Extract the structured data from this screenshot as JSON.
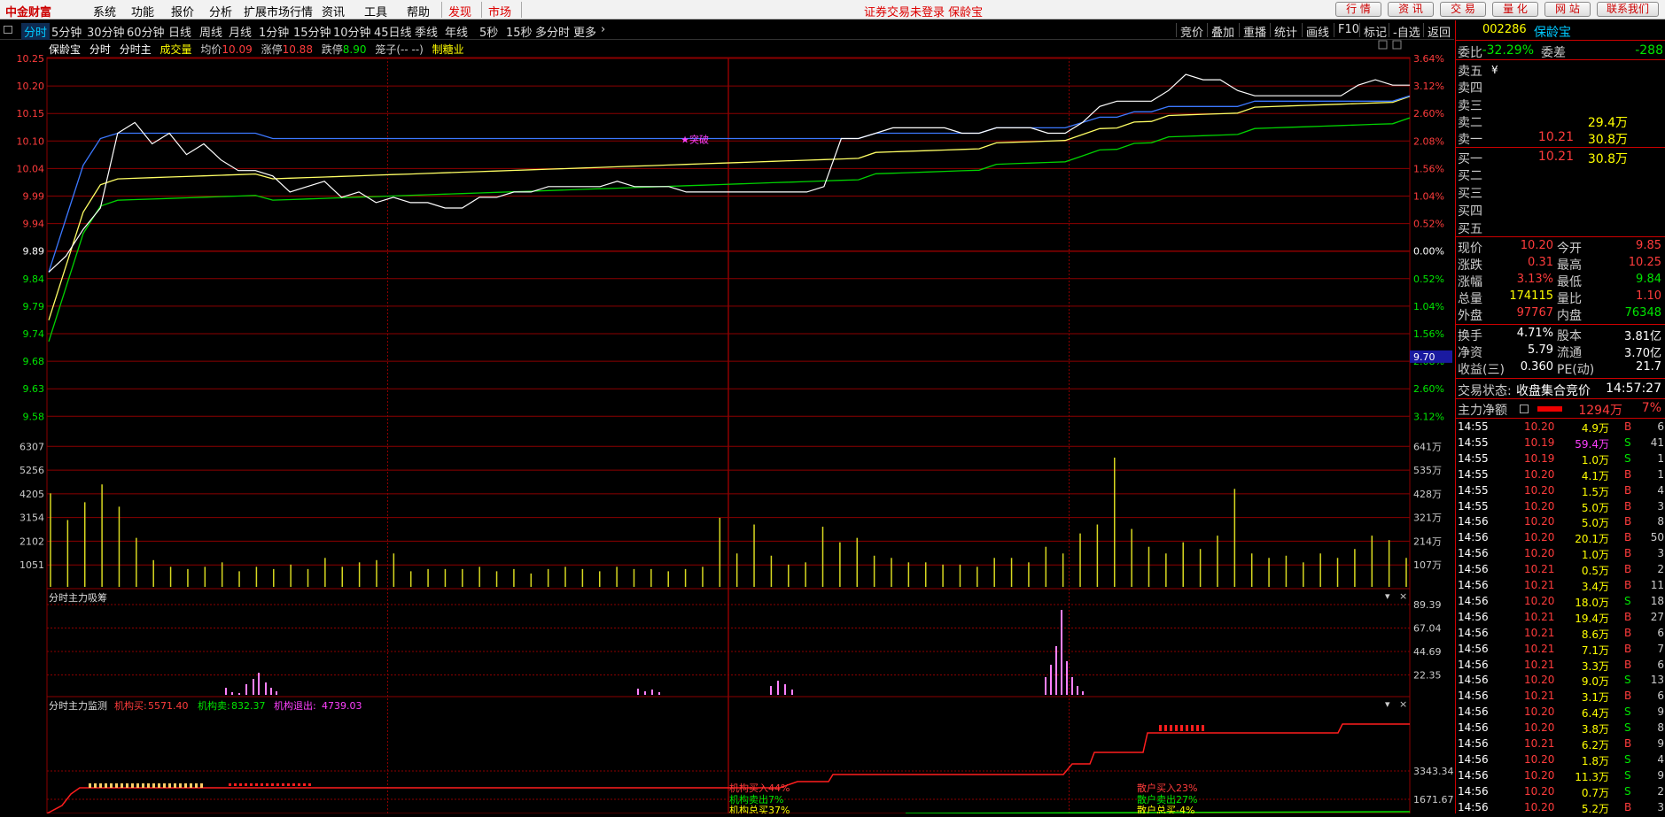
{
  "app": {
    "logo": "中金财富",
    "menu": [
      "系统",
      "功能",
      "报价",
      "分析",
      "扩展市场行情",
      "资讯",
      "工具",
      "帮助"
    ],
    "menu_red": [
      "发现",
      "市场"
    ],
    "notice": "证券交易未登录  保龄宝",
    "buttons": [
      "行 情",
      "资 讯",
      "交 易",
      "量 化",
      "网 站",
      "联系我们"
    ]
  },
  "periods": [
    "分时",
    "5分钟",
    "30分钟",
    "60分钟",
    "日线",
    "周线",
    "月线",
    "1分钟",
    "15分钟",
    "10分钟",
    "45日线",
    "季线",
    "年线",
    "5秒",
    "15秒",
    "多分时",
    "更多"
  ],
  "tools": [
    "竞价",
    "叠加",
    "重播",
    "统计",
    "画线",
    "F10",
    "标记",
    "-自选",
    "返回"
  ],
  "header": {
    "name": "保龄宝",
    "t1": "分时",
    "t2": "分时主",
    "vol": "成交量",
    "avg_label": "均价",
    "avg": "10.09",
    "up_label": "涨停",
    "up": "10.88",
    "dn_label": "跌停",
    "dn": "8.90",
    "note": "笼子(-- --)",
    "sector": "制糖业"
  },
  "price_axis": {
    "left": [
      "10.25",
      "10.20",
      "10.15",
      "10.10",
      "10.04",
      "9.99",
      "9.94",
      "9.89",
      "9.84",
      "9.79",
      "9.74",
      "9.68",
      "9.63",
      "9.58"
    ],
    "right": [
      "3.64%",
      "3.12%",
      "2.60%",
      "2.08%",
      "1.56%",
      "1.04%",
      "0.52%",
      "0.00%",
      "0.52%",
      "1.04%",
      "1.56%",
      "2.08%",
      "2.60%",
      "3.12%"
    ],
    "cursor_value": "9.70",
    "marker": "突破"
  },
  "volume_axis": {
    "left": [
      "6307",
      "5256",
      "4205",
      "3154",
      "2102",
      "1051"
    ],
    "right": [
      "641万",
      "535万",
      "428万",
      "321万",
      "214万",
      "107万"
    ]
  },
  "panel2": {
    "title": "分时主力吸筹",
    "right": [
      "89.39",
      "67.04",
      "44.69",
      "22.35"
    ]
  },
  "panel3": {
    "title": "分时主力监测",
    "buy_label": "机构买:",
    "buy": "5571.40",
    "sell_label": "机构卖:",
    "sell": "832.37",
    "exit_label": "机构退出:",
    "exit": "4739.03",
    "right": [
      "3343.34",
      "1671.67"
    ],
    "annots": [
      "机构买入44%",
      "机构卖出7%",
      "机构总买37%",
      "散户买入23%",
      "散户卖出27%",
      "散户总买-4%"
    ]
  },
  "quote": {
    "code": "002286",
    "name": "保龄宝",
    "wb_label": "委比",
    "wb": "-32.29%",
    "wc_label": "委差",
    "wc": "-288",
    "asks": [
      {
        "l": "卖五",
        "p": "",
        "v": ""
      },
      {
        "l": "卖四",
        "p": "",
        "v": ""
      },
      {
        "l": "卖三",
        "p": "",
        "v": ""
      },
      {
        "l": "卖二",
        "p": "",
        "v": "29.4万"
      },
      {
        "l": "卖一",
        "p": "10.21",
        "v": "30.8万"
      }
    ],
    "bids": [
      {
        "l": "买一",
        "p": "10.21",
        "v": "30.8万"
      },
      {
        "l": "买二",
        "p": "",
        "v": ""
      },
      {
        "l": "买三",
        "p": "",
        "v": ""
      },
      {
        "l": "买四",
        "p": "",
        "v": ""
      },
      {
        "l": "买五",
        "p": "",
        "v": ""
      }
    ],
    "stats": [
      [
        "现价",
        "10.20",
        "今开",
        "9.85"
      ],
      [
        "涨跌",
        "0.31",
        "最高",
        "10.25"
      ],
      [
        "涨幅",
        "3.13%",
        "最低",
        "9.84"
      ],
      [
        "总量",
        "174115",
        "量比",
        "1.10"
      ],
      [
        "外盘",
        "97767",
        "内盘",
        "76348"
      ]
    ],
    "stats2": [
      [
        "换手",
        "4.71%",
        "股本",
        "3.81亿"
      ],
      [
        "净资",
        "5.79",
        "流通",
        "3.70亿"
      ],
      [
        "收益(三)",
        "0.360",
        "PE(动)",
        "21.7"
      ]
    ],
    "status_label": "交易状态:",
    "status": "收盘集合竞价",
    "time": "14:57:27",
    "mainnet_label": "主力净额",
    "mainnet": "1294万",
    "mainnet_pct": "7%"
  },
  "ticks": [
    [
      "14:55",
      "10.20",
      "4.9万",
      "B",
      "6"
    ],
    [
      "14:55",
      "10.19",
      "59.4万",
      "S",
      "41"
    ],
    [
      "14:55",
      "10.19",
      "1.0万",
      "S",
      "1"
    ],
    [
      "14:55",
      "10.20",
      "4.1万",
      "B",
      "1"
    ],
    [
      "14:55",
      "10.20",
      "1.5万",
      "B",
      "4"
    ],
    [
      "14:55",
      "10.20",
      "5.0万",
      "B",
      "3"
    ],
    [
      "14:56",
      "10.20",
      "5.0万",
      "B",
      "8"
    ],
    [
      "14:56",
      "10.20",
      "20.1万",
      "B",
      "50"
    ],
    [
      "14:56",
      "10.20",
      "1.0万",
      "B",
      "3"
    ],
    [
      "14:56",
      "10.21",
      "0.5万",
      "B",
      "2"
    ],
    [
      "14:56",
      "10.21",
      "3.4万",
      "B",
      "11"
    ],
    [
      "14:56",
      "10.20",
      "18.0万",
      "S",
      "18"
    ],
    [
      "14:56",
      "10.21",
      "19.4万",
      "B",
      "27"
    ],
    [
      "14:56",
      "10.21",
      "8.6万",
      "B",
      "6"
    ],
    [
      "14:56",
      "10.21",
      "7.1万",
      "B",
      "7"
    ],
    [
      "14:56",
      "10.21",
      "3.3万",
      "B",
      "6"
    ],
    [
      "14:56",
      "10.20",
      "9.0万",
      "S",
      "13"
    ],
    [
      "14:56",
      "10.21",
      "3.1万",
      "B",
      "6"
    ],
    [
      "14:56",
      "10.20",
      "6.4万",
      "S",
      "9"
    ],
    [
      "14:56",
      "10.20",
      "3.8万",
      "S",
      "8"
    ],
    [
      "14:56",
      "10.21",
      "6.2万",
      "B",
      "9"
    ],
    [
      "14:56",
      "10.20",
      "1.8万",
      "S",
      "4"
    ],
    [
      "14:56",
      "10.20",
      "11.3万",
      "S",
      "9"
    ],
    [
      "14:56",
      "10.20",
      "0.7万",
      "S",
      "2"
    ],
    [
      "14:56",
      "10.20",
      "5.2万",
      "B",
      "3"
    ]
  ],
  "colors": {
    "up": "#ff3c3c",
    "down": "#00e600",
    "yellow": "#ffff00",
    "grid": "#8c0000",
    "price_line": "#ffffff",
    "avg_line": "#3c78ff",
    "ma1": "#ffff64",
    "ma2": "#00d200",
    "accum": "#ff80ff",
    "monitor": "#ff1e1e"
  },
  "chart_data": [
    {
      "type": "line",
      "title": "分时",
      "series": [
        {
          "name": "",
          "values": [
            9.85,
            9.88,
            9.93,
            9.97,
            10.11,
            10.13,
            10.09,
            10.11,
            10.07,
            10.09,
            10.06,
            10.04,
            10.04,
            10.03,
            10.0,
            10.01,
            10.02,
            9.99,
            10.0,
            9.98,
            9.99,
            9.98,
            9.98,
            9.97,
            9.97,
            9.99,
            9.99,
            10.0,
            10.0,
            10.01,
            10.01,
            10.01,
            10.01,
            10.02,
            10.01,
            10.01,
            10.01,
            10.0,
            10.0,
            10.0,
            10.0,
            10.0,
            10.0,
            10.0,
            10.0,
            10.01,
            10.1,
            10.1,
            10.11,
            10.12,
            10.12,
            10.12,
            10.12,
            10.11,
            10.11,
            10.12,
            10.12,
            10.12,
            10.11,
            10.11,
            10.13,
            10.16,
            10.17,
            10.17,
            10.17,
            10.19,
            10.22,
            10.21,
            10.21,
            10.19,
            10.18,
            10.18,
            10.18,
            10.18,
            10.18,
            10.18,
            10.2,
            10.21,
            10.2,
            10.2
          ]
        },
        {
          "name": "均价",
          "values": [
            9.85,
            9.95,
            10.05,
            10.1,
            10.11,
            10.11,
            10.11,
            10.11,
            10.11,
            10.11,
            10.11,
            10.11,
            10.11,
            10.1,
            10.1,
            10.1,
            10.1,
            10.1,
            10.1,
            10.1,
            10.1,
            10.1,
            10.1,
            10.1,
            10.1,
            10.1,
            10.1,
            10.1,
            10.1,
            10.1,
            10.1,
            10.1,
            10.1,
            10.1,
            10.1,
            10.1,
            10.1,
            10.1,
            10.1,
            10.1,
            10.1,
            10.1,
            10.1,
            10.1,
            10.1,
            10.1,
            10.1,
            10.1,
            10.11,
            10.11,
            10.11,
            10.11,
            10.11,
            10.11,
            10.11,
            10.12,
            10.12,
            10.12,
            10.12,
            10.12,
            10.13,
            10.14,
            10.14,
            10.15,
            10.15,
            10.16,
            10.16,
            10.16,
            10.16,
            10.16,
            10.17,
            10.17,
            10.17,
            10.17,
            10.17,
            10.17,
            10.17,
            10.17,
            10.17,
            10.18
          ]
        }
      ]
    },
    {
      "type": "bar",
      "title": "成交量",
      "values": [
        4200,
        3000,
        3800,
        4600,
        3600,
        2200,
        1200,
        900,
        800,
        900,
        1100,
        700,
        900,
        800,
        1000,
        800,
        1300,
        900,
        1100,
        1200,
        1500,
        700,
        800,
        800,
        800,
        900,
        700,
        800,
        600,
        800,
        900,
        800,
        700,
        900,
        800,
        800,
        700,
        800,
        900,
        3100,
        1500,
        2800,
        1400,
        1000,
        1100,
        2700,
        2000,
        2200,
        1400,
        1300,
        1100,
        1100,
        1000,
        1000,
        900,
        1300,
        1300,
        1100,
        1800,
        1500,
        2400,
        2800,
        5800,
        2600,
        1800,
        1500,
        2000,
        1700,
        2300,
        4400,
        1500,
        1300,
        1400,
        1100,
        1500,
        1300,
        1700,
        2300,
        2100,
        1300
      ]
    }
  ]
}
